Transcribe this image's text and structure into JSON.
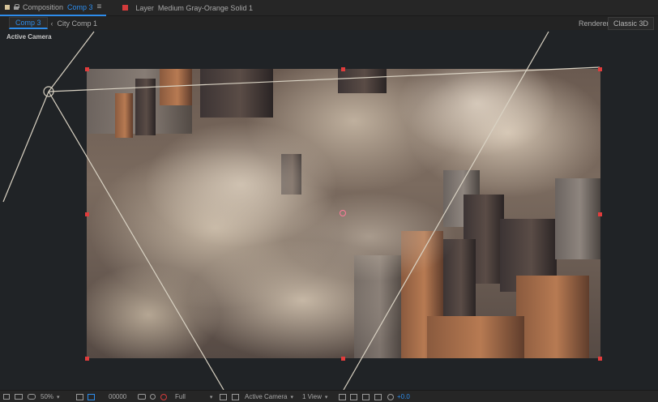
{
  "tabs": {
    "composition": {
      "prefix": "Composition",
      "name": "Comp 3",
      "menu_icon": "hamburger-icon"
    },
    "layer": {
      "prefix": "Layer",
      "name": "Medium Gray-Orange Solid 1",
      "swatch_color": "#d33b3b"
    }
  },
  "breadcrumb": {
    "active": "Comp 3",
    "separator": "‹",
    "next": "City Comp 1"
  },
  "renderer": {
    "label": "Renderer:",
    "value": "Classic 3D"
  },
  "viewer": {
    "view_label": "Active Camera"
  },
  "bottom": {
    "magnification": "50%",
    "timecode": "00000",
    "resolution": "Full",
    "view": "Active Camera",
    "layout": "1 View",
    "exposure": "+0.0"
  },
  "colors": {
    "accent": "#2d8ceb",
    "handle": "#e03c3c",
    "wireframe": "#d9d2c3"
  }
}
